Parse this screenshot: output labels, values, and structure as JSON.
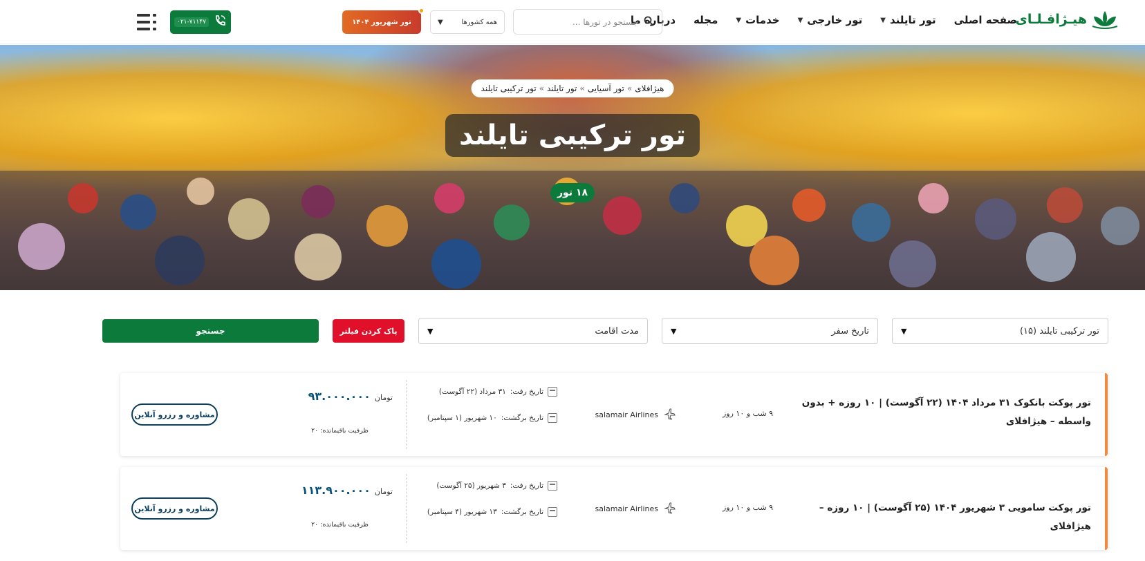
{
  "header": {
    "logo_text": "هیـژافـلـای",
    "nav": [
      {
        "label": "صفحه اصلی",
        "dropdown": false
      },
      {
        "label": "تور تایلند",
        "dropdown": true
      },
      {
        "label": "تور خارجی",
        "dropdown": true
      },
      {
        "label": "خدمات",
        "dropdown": true
      },
      {
        "label": "مجله",
        "dropdown": false
      },
      {
        "label": "درباره ما",
        "dropdown": false
      }
    ],
    "search_placeholder": "جستجو در تورها ...",
    "country_select": "همه کشورها",
    "promo_label": "تور شهریور ۱۴۰۴",
    "phone": "۰۲۱-۷۱۱۴۷"
  },
  "hero": {
    "breadcrumb": [
      "هیژافلای",
      "تور آسیایی",
      "تور تایلند",
      "تور ترکیبی تایلند"
    ],
    "breadcrumb_sep": "»",
    "title": "تور ترکیبی تایلند",
    "count": "۱۸ تور"
  },
  "filters": {
    "tour_type": "تور ترکیبی تایلند (۱۵)",
    "travel_date": "تاریخ سفر",
    "duration": "مدت اقامت",
    "clear_label": "پاک کردن فیلتر",
    "search_label": "جستجو"
  },
  "labels": {
    "depart": "تاریخ رفت:",
    "return": "تاریخ برگشت:",
    "currency": "تومان",
    "capacity": "ظرفیت باقیمانده:",
    "book": "مشاوره و رزرو آنلاین"
  },
  "tours": [
    {
      "title": "تور پوکت بانکوک ۳۱ مرداد ۱۴۰۴ (۲۲ آگوست) | ۱۰ روزه + بدون واسطه – هیژافلای",
      "duration": "۹ شب و ۱۰ روز",
      "airline": "salamair Airlines",
      "depart": "۳۱ مرداد (۲۲ آگوست)",
      "return": "۱۰ شهریور (۱ سپتامبر)",
      "price": "۹۳.۰۰۰.۰۰۰",
      "capacity": "۲۰"
    },
    {
      "title": "تور پوکت سامویی ۳ شهریور ۱۴۰۴ (۲۵ آگوست) | ۱۰ روزه – هیژافلای",
      "duration": "۹ شب و ۱۰ روز",
      "airline": "salamair Airlines",
      "depart": "۳ شهریور (۲۵ آگوست)",
      "return": "۱۳ شهریور (۴ سپتامبر)",
      "price": "۱۱۳.۹۰۰.۰۰۰",
      "capacity": "۲۰"
    }
  ]
}
